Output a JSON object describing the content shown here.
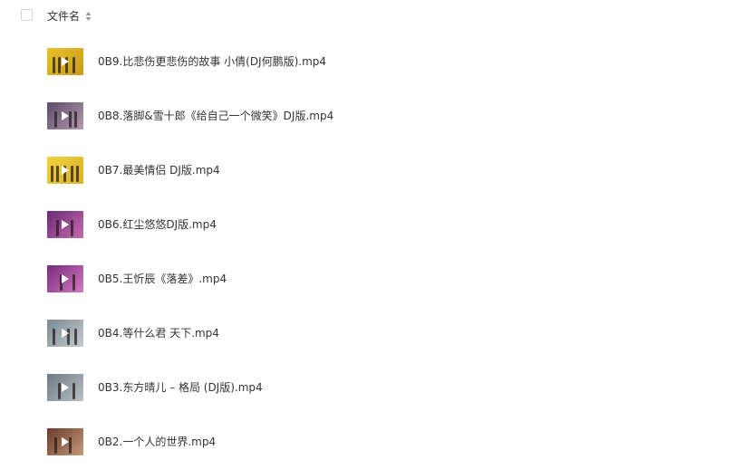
{
  "header": {
    "column_title": "文件名",
    "sort_icon": "sort-icon"
  },
  "files": [
    {
      "name": "0B9.比悲伤更悲伤的故事 小倩(DJ何鹏版).mp4",
      "thumb_bg": "#e7c12a",
      "thumb_bg2": "#c99a1a"
    },
    {
      "name": "0B8.落脚&雪十郎《给自己一个微笑》DJ版.mp4",
      "thumb_bg": "#5a4a66",
      "thumb_bg2": "#b69ab0"
    },
    {
      "name": "0B7.最美情侣 DJ版.mp4",
      "thumb_bg": "#f2d23c",
      "thumb_bg2": "#d8b22a"
    },
    {
      "name": "0B6.红尘悠悠DJ版.mp4",
      "thumb_bg": "#6a2a72",
      "thumb_bg2": "#c86ab0"
    },
    {
      "name": "0B5.王忻辰《落差》.mp4",
      "thumb_bg": "#7a2a7a",
      "thumb_bg2": "#d07ac0"
    },
    {
      "name": "0B4.等什么君 天下.mp4",
      "thumb_bg": "#7a8890",
      "thumb_bg2": "#c4ccd0"
    },
    {
      "name": "0B3.东方晴儿 – 格局 (DJ版).mp4",
      "thumb_bg": "#6e7a84",
      "thumb_bg2": "#b8c0c6"
    },
    {
      "name": "0B2.一个人的世界.mp4",
      "thumb_bg": "#6a3a2a",
      "thumb_bg2": "#c49a7a"
    }
  ],
  "icons": {
    "checkbox": "checkbox-icon",
    "play": "play-icon",
    "thumbnail": "video-thumbnail-icon"
  },
  "colors": {
    "text": "#333333",
    "checkbox_border": "#d4d4d4",
    "sort_icon": "#999999"
  }
}
